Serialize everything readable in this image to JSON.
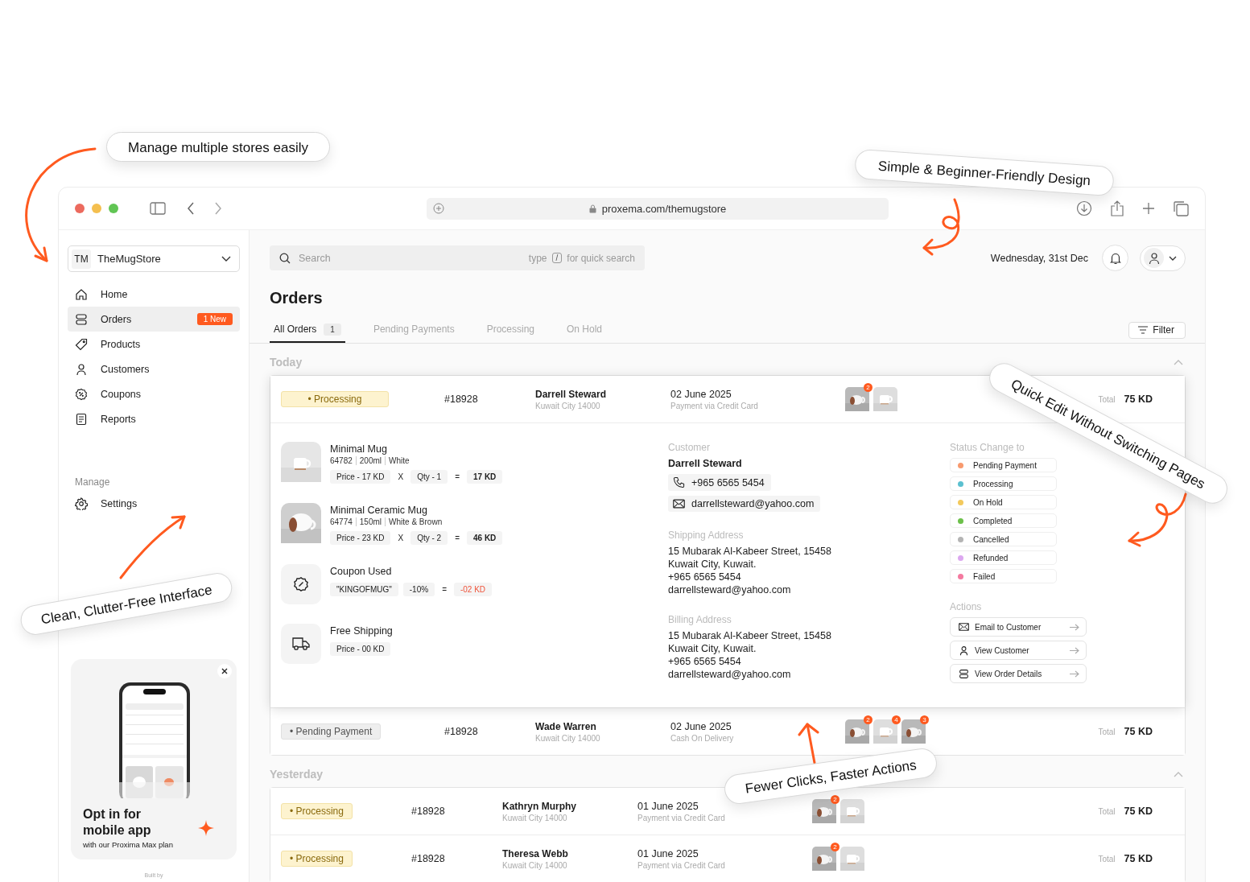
{
  "callouts": [
    {
      "text": "Manage multiple stores easily"
    },
    {
      "text": "Simple & Beginner-Friendly Design"
    },
    {
      "text": "Quick Edit Without Switching Pages"
    },
    {
      "text": "Clean, Clutter-Free Interface"
    },
    {
      "text": "Fewer Clicks, Faster Actions"
    }
  ],
  "browser": {
    "url": "proxema.com/themugstore"
  },
  "sidebar": {
    "store_initials": "TM",
    "store_name": "TheMugStore",
    "items": [
      {
        "label": "Home",
        "kind": "home",
        "selected": false
      },
      {
        "label": "Orders",
        "kind": "orders",
        "selected": true,
        "badge": "1 New"
      },
      {
        "label": "Products",
        "kind": "products",
        "selected": false
      },
      {
        "label": "Customers",
        "kind": "customers",
        "selected": false
      },
      {
        "label": "Coupons",
        "kind": "coupons",
        "selected": false
      },
      {
        "label": "Reports",
        "kind": "reports",
        "selected": false
      }
    ],
    "section_label": "Manage",
    "manage_items": [
      {
        "label": "Settings",
        "kind": "settings",
        "selected": false
      }
    ],
    "promo": {
      "kind": "picture",
      "title": "Opt in for mobile app",
      "subtitle": "with our Proxima Max plan"
    },
    "footer": "Built by"
  },
  "search": {
    "placeholder": "Search",
    "hint_before": "type",
    "key": "/",
    "hint_after": "for quick search"
  },
  "date": "Wednesday, 31st Dec",
  "page_title": "Orders",
  "tabs": [
    {
      "label": "All Orders",
      "count": "1",
      "selected": true
    },
    {
      "label": "Pending Payments",
      "selected": false
    },
    {
      "label": "Processing",
      "selected": false
    },
    {
      "label": "On Hold",
      "selected": false
    }
  ],
  "filter_button": "Filter",
  "groups": [
    {
      "label": "Today",
      "expanded": true,
      "orders": [
        {
          "status": "• Processing",
          "kind": "processing",
          "id": "#18928",
          "customer": "Darrell Steward",
          "city": "Kuwait City 14000",
          "date": "02 June 2025",
          "payment": "Payment via Credit Card",
          "thumbs": [
            {
              "kind": "picture",
              "count": "2"
            },
            {
              "kind": "picture"
            }
          ],
          "total_label": "Total",
          "total": "75 KD",
          "expanded": true,
          "details": {
            "items": [
              {
                "kind": "product",
                "name": "Minimal Mug",
                "meta": [
                  "64782",
                  "200ml",
                  "White"
                ],
                "price": "Price - 17 KD",
                "times": "X",
                "qty": "Qty - 1",
                "equals": "=",
                "amount": "17 KD"
              },
              {
                "kind": "product",
                "name": "Minimal Ceramic Mug",
                "meta": [
                  "64774",
                  "150ml",
                  "White & Brown"
                ],
                "price": "Price - 23 KD",
                "times": "X",
                "qty": "Qty - 2",
                "equals": "=",
                "amount": "46 KD"
              },
              {
                "kind": "coupon",
                "name": "Coupon Used",
                "code": "\"KINGOFMUG\"",
                "discount": "-10%",
                "equals": "=",
                "amount": "-02 KD"
              },
              {
                "kind": "shipping",
                "name": "Free Shipping",
                "price": "Price - 00 KD"
              }
            ],
            "customer_label": "Customer",
            "customer_name": "Darrell Steward",
            "phone": "+965 6565 5454",
            "email": "darrellsteward@yahoo.com",
            "addresses": [
              {
                "label": "Shipping Address",
                "lines": [
                  "15 Mubarak Al-Kabeer Street, 15458",
                  "Kuwait City, Kuwait.",
                  "+965 6565 5454",
                  "darrellsteward@yahoo.com"
                ]
              },
              {
                "label": "Billing Address",
                "lines": [
                  "15 Mubarak Al-Kabeer Street, 15458",
                  "Kuwait City, Kuwait.",
                  "+965 6565 5454",
                  "darrellsteward@yahoo.com"
                ]
              }
            ],
            "status_label": "Status Change to",
            "status_options": [
              {
                "label": "Pending Payment",
                "color": "#f89a6e"
              },
              {
                "label": "Processing",
                "color": "#5bc0d0"
              },
              {
                "label": "On Hold",
                "color": "#f3c95c"
              },
              {
                "label": "Completed",
                "color": "#6cc04a"
              },
              {
                "label": "Cancelled",
                "color": "#b4b4b4"
              },
              {
                "label": "Refunded",
                "color": "#dca8f0"
              },
              {
                "label": "Failed",
                "color": "#f47aa0"
              }
            ],
            "actions_label": "Actions",
            "actions": [
              {
                "label": "Email to Customer",
                "kind": "email"
              },
              {
                "label": "View Customer",
                "kind": "customer"
              },
              {
                "label": "View Order Details",
                "kind": "details"
              }
            ]
          }
        },
        {
          "status": "• Pending Payment",
          "kind": "pending",
          "id": "#18928",
          "customer": "Wade Warren",
          "city": "Kuwait City 14000",
          "date": "02 June 2025",
          "payment": "Cash On Delivery",
          "thumbs": [
            {
              "kind": "picture",
              "count": "2"
            },
            {
              "kind": "picture",
              "count": "4"
            },
            {
              "kind": "picture",
              "count": "3"
            }
          ],
          "total_label": "Total",
          "total": "75 KD",
          "expanded": false
        }
      ]
    },
    {
      "label": "Yesterday",
      "expanded": true,
      "orders": [
        {
          "status": "• Processing",
          "kind": "processing",
          "id": "#18928",
          "customer": "Kathryn Murphy",
          "city": "Kuwait City 14000",
          "date": "01 June 2025",
          "payment": "Payment via Credit Card",
          "thumbs": [
            {
              "kind": "picture",
              "count": "2"
            },
            {
              "kind": "picture"
            }
          ],
          "total_label": "Total",
          "total": "75 KD",
          "expanded": false
        },
        {
          "status": "• Processing",
          "kind": "processing",
          "id": "#18928",
          "customer": "Theresa Webb",
          "city": "Kuwait City 14000",
          "date": "01 June 2025",
          "payment": "Payment via Credit Card",
          "thumbs": [
            {
              "kind": "picture",
              "count": "2"
            },
            {
              "kind": "picture"
            }
          ],
          "total_label": "Total",
          "total": "75 KD",
          "expanded": false
        }
      ]
    }
  ]
}
